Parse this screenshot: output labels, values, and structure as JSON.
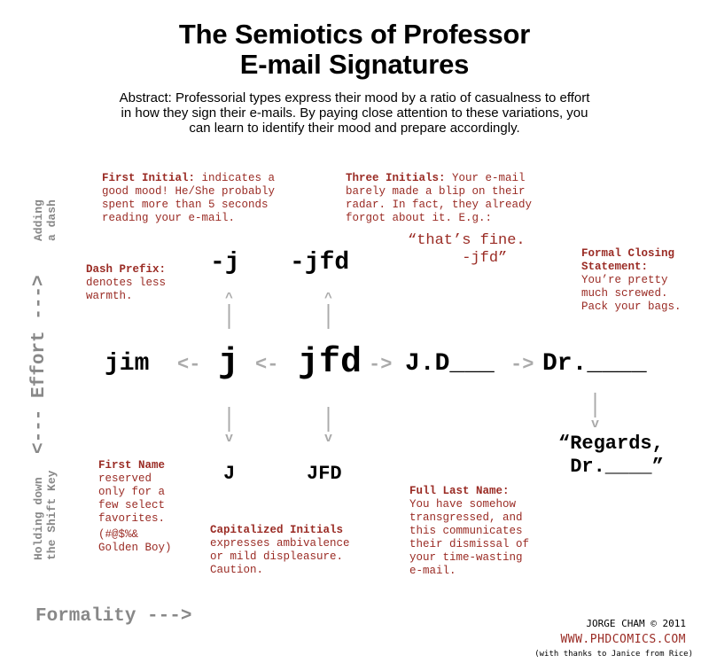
{
  "title": {
    "line1": "The Semiotics of Professor",
    "line2": "E-mail Signatures"
  },
  "abstract": {
    "line1": "Abstract: Professorial types express their mood by a ratio of casualness to effort",
    "line2": "in how they sign their e-mails. By paying close attention to these variations, you",
    "line3": "can learn to identify their mood and prepare accordingly."
  },
  "signatures": {
    "jim": "jim",
    "j": "j",
    "jfd": "jfd",
    "jd": "J.D___",
    "dr": "Dr.____",
    "dash_j": "-j",
    "dash_jfd": "-jfd",
    "cap_j": "J",
    "cap_jfd": "JFD"
  },
  "arrows": {
    "left1": "<-",
    "left2": "<-",
    "right1": "->",
    "right2": "->",
    "up": "^\n|\n|",
    "down": "|\n|\nv"
  },
  "notes": {
    "first_initial": {
      "head": "First Initial:",
      "body": " indicates a\ngood mood! He/She probably\nspent more than 5 seconds\nreading your e-mail."
    },
    "three_initials": {
      "head": "Three Initials:",
      "body": " Your e-mail\nbarely made a blip on their\nradar. In fact, they already\nforgot about it. E.g.:"
    },
    "dash_prefix": {
      "head": "Dash Prefix:",
      "body": "\ndenotes less\nwarmth."
    },
    "formal_closing": {
      "head": "Formal Closing\nStatement:",
      "body": "\nYou’re pretty\nmuch screwed.\nPack your bags."
    },
    "first_name": {
      "head": "First Name",
      "body": "\nreserved\nonly for a\nfew select\nfavorites.",
      "aside": "(#@$%&\nGolden Boy)"
    },
    "capitalized": {
      "head": "Capitalized Initials",
      "body": "\nexpresses ambivalence\nor mild displeasure.\nCaution."
    },
    "full_last_name": {
      "head": "Full Last Name:",
      "body": "\nYou have somehow\ntransgressed, and\nthis communicates\ntheir dismissal of\nyour time-wasting\ne-mail."
    }
  },
  "examples": {
    "thats_fine": "“that’s fine.\n      -jfd”",
    "regards": "“Regards,\n Dr.____”"
  },
  "axes": {
    "effort": "<--- Effort --->",
    "adding_dash": "Adding\na dash",
    "holding_shift": "Holding down\nthe Shift Key",
    "formality": "Formality --->"
  },
  "credits": {
    "author": "JORGE CHAM © 2011",
    "site": "WWW.PHDCOMICS.COM",
    "thanks": "(with thanks to Janice from Rice)"
  }
}
